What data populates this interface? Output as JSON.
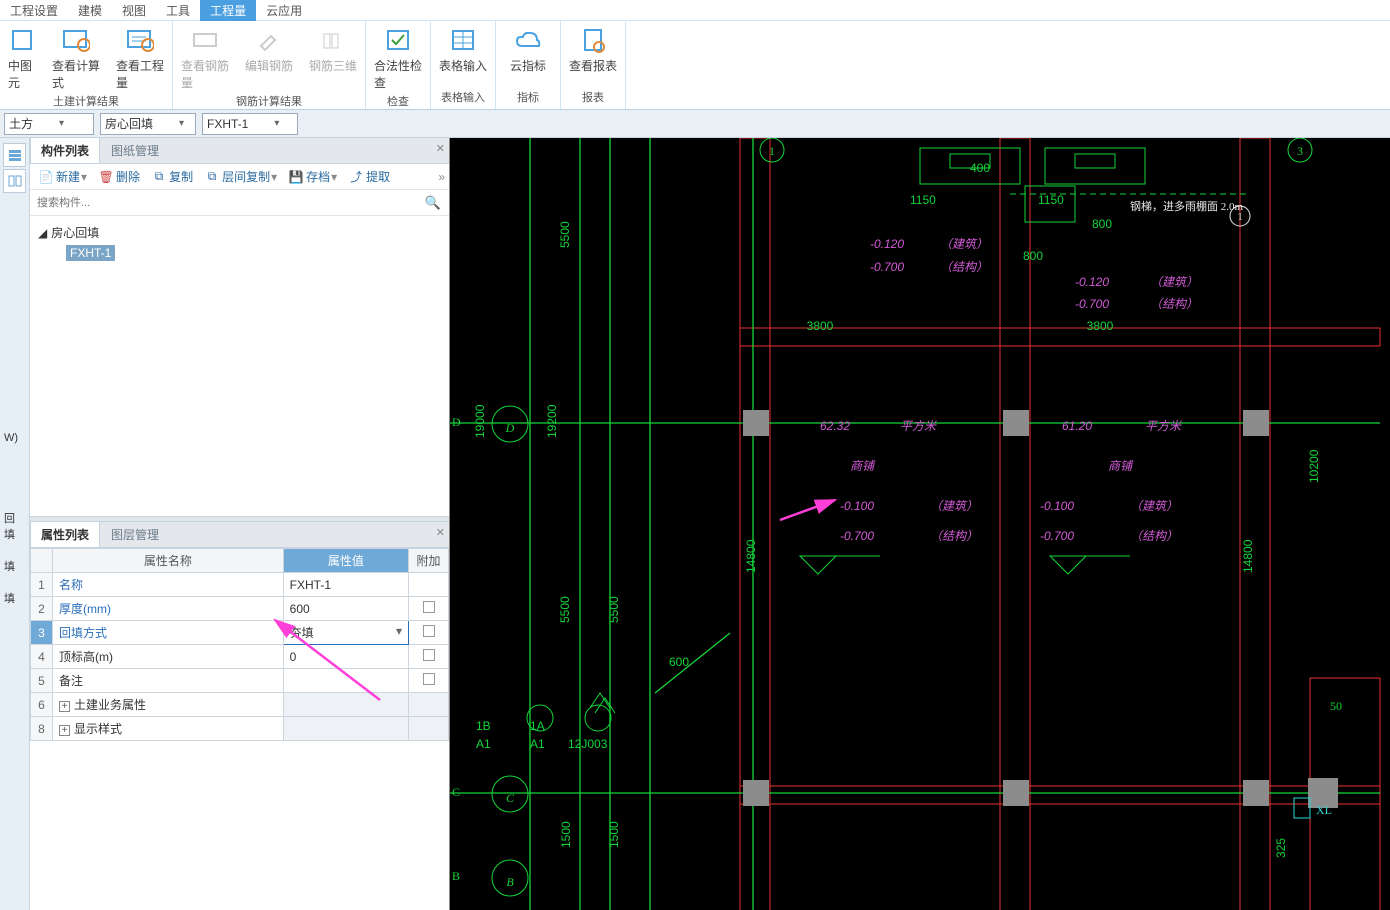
{
  "menu": [
    "工程设置",
    "建模",
    "视图",
    "工具",
    "工程量",
    "云应用"
  ],
  "menu_active_index": 4,
  "ribbon": {
    "groups": [
      {
        "label": "土建计算结果",
        "items": [
          {
            "label": "中图元",
            "disabled": false
          },
          {
            "label": "查看计算式",
            "disabled": false
          },
          {
            "label": "查看工程量",
            "disabled": false
          }
        ]
      },
      {
        "label": "钢筋计算结果",
        "items": [
          {
            "label": "查看钢筋量",
            "disabled": true
          },
          {
            "label": "编辑钢筋",
            "disabled": true
          },
          {
            "label": "钢筋三维",
            "disabled": true
          }
        ]
      },
      {
        "label": "检查",
        "items": [
          {
            "label": "合法性检查",
            "disabled": false
          }
        ]
      },
      {
        "label": "表格输入",
        "items": [
          {
            "label": "表格输入",
            "disabled": false
          }
        ]
      },
      {
        "label": "指标",
        "items": [
          {
            "label": "云指标",
            "disabled": false
          }
        ]
      },
      {
        "label": "报表",
        "items": [
          {
            "label": "查看报表",
            "disabled": false
          }
        ]
      }
    ]
  },
  "selectors": {
    "s1": "土方",
    "s2": "房心回填",
    "s3": "FXHT-1"
  },
  "left_labels": [
    "W)",
    "回填",
    "填",
    "填"
  ],
  "component_panel": {
    "tabs": [
      "构件列表",
      "图纸管理"
    ],
    "active": 0,
    "toolbar": [
      "新建",
      "删除",
      "复制",
      "层间复制",
      "存档",
      "提取"
    ],
    "search_placeholder": "搜索构件...",
    "tree_root": "房心回填",
    "tree_child": "FXHT-1"
  },
  "prop_panel": {
    "tabs": [
      "属性列表",
      "图层管理"
    ],
    "active": 0,
    "headers": [
      "属性名称",
      "属性值",
      "附加"
    ],
    "rows": [
      {
        "n": "1",
        "label": "名称",
        "value": "FXHT-1",
        "link": true,
        "chk": false
      },
      {
        "n": "2",
        "label": "厚度(mm)",
        "value": "600",
        "link": true,
        "chk": true
      },
      {
        "n": "3",
        "label": "回填方式",
        "value": "夯填",
        "link": true,
        "chk": true,
        "selected": true,
        "dropdown": true
      },
      {
        "n": "4",
        "label": "顶标高(m)",
        "value": "0",
        "link": false,
        "chk": true
      },
      {
        "n": "5",
        "label": "备注",
        "value": "",
        "link": false,
        "chk": true
      },
      {
        "n": "6",
        "label": "土建业务属性",
        "value": "",
        "expand": true
      },
      {
        "n": "8",
        "label": "显示样式",
        "value": "",
        "expand": true
      }
    ]
  },
  "canvas": {
    "grids_top": [
      "1",
      "3"
    ],
    "grids_left": [
      "D",
      "C",
      "B"
    ],
    "dims_h": [
      "1150",
      "1150",
      "800",
      "800",
      "3800",
      "3800",
      "600",
      "400"
    ],
    "dims_v": [
      "5500",
      "19000",
      "19200",
      "5500",
      "5500",
      "14800",
      "14800",
      "10200",
      "1500",
      "1500",
      "325"
    ],
    "room1": {
      "area": "62.32",
      "unit": "平方米",
      "name": "商铺",
      "e1": "-0.100",
      "t1": "（建筑）",
      "e2": "-0.700",
      "t2": "（结构）"
    },
    "room2": {
      "area": "61.20",
      "unit": "平方米",
      "name": "商铺",
      "e1": "-0.100",
      "t1": "（建筑）",
      "e2": "-0.700",
      "t2": "（结构）"
    },
    "block1": {
      "e1": "-0.120",
      "t1": "（建筑）",
      "e2": "-0.700",
      "t2": "（结构）"
    },
    "block2": {
      "e1": "-0.120",
      "t1": "（建筑）",
      "e2": "-0.700",
      "t2": "（结构）"
    },
    "bottom_labels": {
      "b1": "1B",
      "b2": "1A",
      "a1": "A1",
      "a2": "A1",
      "code": "12J003"
    },
    "note": "钢梯，进多雨棚面 2.0m",
    "gnum": "1",
    "xl": "XL",
    "num50": "50"
  }
}
